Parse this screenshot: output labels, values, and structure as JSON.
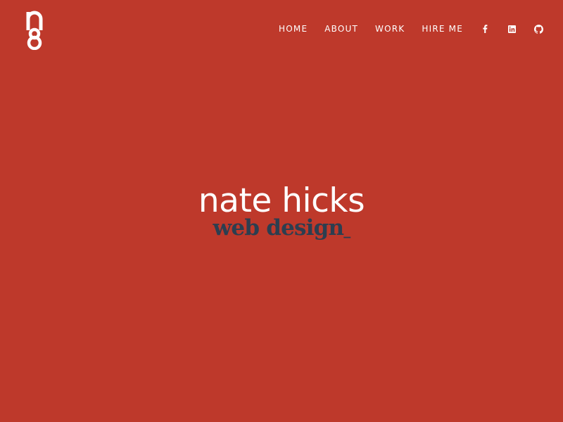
{
  "header": {
    "logo_icon": "ng-monogram-logo",
    "nav": [
      {
        "label": "HOME"
      },
      {
        "label": "ABOUT"
      },
      {
        "label": "WORK"
      },
      {
        "label": "HIRE ME"
      }
    ],
    "social": [
      {
        "icon": "facebook-icon"
      },
      {
        "icon": "linkedin-icon"
      },
      {
        "icon": "github-icon"
      }
    ]
  },
  "hero": {
    "name": "nate hicks",
    "tagline": "web design",
    "cursor": "_"
  },
  "colors": {
    "background": "#be392b",
    "primary_text": "#ffffff",
    "accent_text": "#2c3e50"
  }
}
